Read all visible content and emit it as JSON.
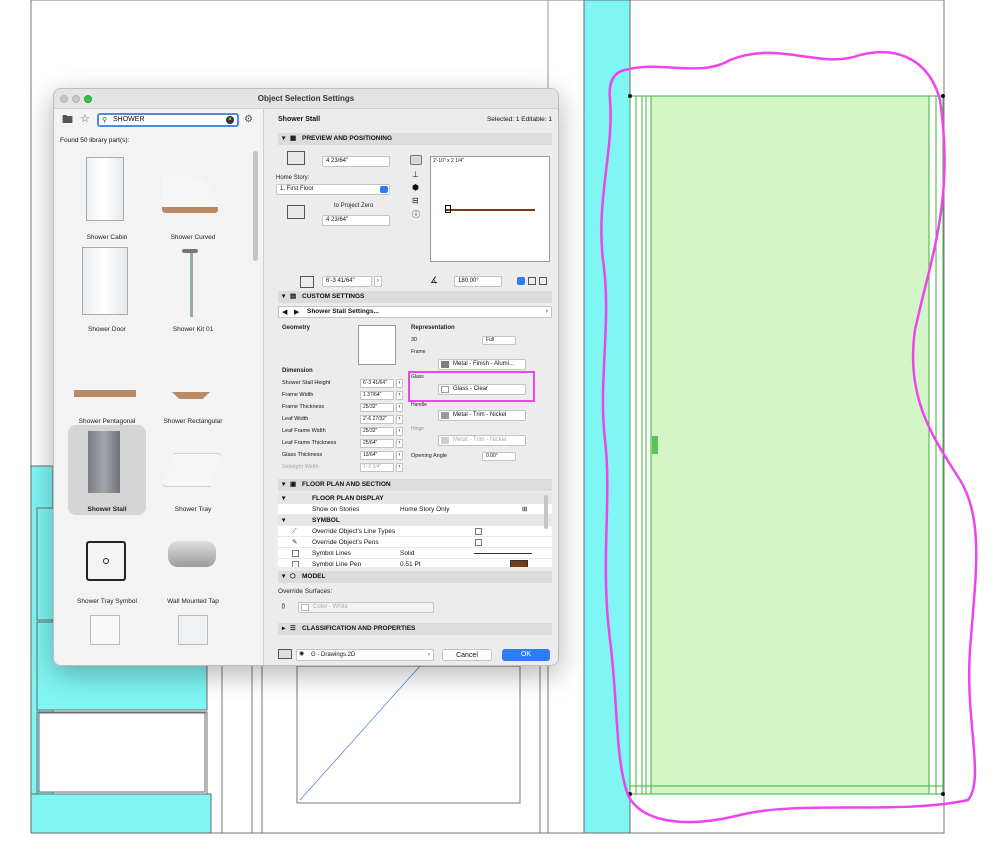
{
  "dialog": {
    "title": "Object Selection Settings",
    "search_value": "SHOWER",
    "found_text": "Found 50 library part(s):",
    "items": [
      {
        "label": "Shower Cabin"
      },
      {
        "label": "Shower Curved"
      },
      {
        "label": "Shower Door"
      },
      {
        "label": "Shower Kit 01"
      },
      {
        "label": "Shower Pentagonal"
      },
      {
        "label": "Shower Rectangular"
      },
      {
        "label": "Shower Stall"
      },
      {
        "label": "Shower Tray"
      },
      {
        "label": "Shower Tray Symbol"
      },
      {
        "label": "Wall Mounted Tap"
      }
    ],
    "selected_item": "Shower Stall",
    "header_name": "Shower Stall",
    "selected_info": "Selected: 1 Editable: 1",
    "preview": {
      "section_title": "PREVIEW AND POSITIONING",
      "top_value": "4 23/64\"",
      "home_story_label": "Home Story:",
      "home_story_value": "1. First Floor",
      "to_project_zero": "to Project Zero",
      "bottom_value": "4 23/64\"",
      "preview_caption": "2'-10\" x 2 1/4\"",
      "size_value": "6'-3 41/64\"",
      "angle_value": "180.00°"
    },
    "custom": {
      "section_title": "CUSTOM SETTINGS",
      "settings_name": "Shower Stall Settings...",
      "geometry_label": "Geometry",
      "dimension_label": "Dimension",
      "dims": [
        {
          "label": "Shower Stall Height",
          "value": "6'-3 41/64\""
        },
        {
          "label": "Frame Width",
          "value": "1 37/64\""
        },
        {
          "label": "Frame Thickness",
          "value": "25/32\""
        },
        {
          "label": "Leaf Width",
          "value": "2'-6 27/32\""
        },
        {
          "label": "Leaf Frame Width",
          "value": "25/32\""
        },
        {
          "label": "Leaf Frame Thickness",
          "value": "25/64\""
        },
        {
          "label": "Glass Thickness",
          "value": "13/64\""
        },
        {
          "label": "Sidelight Width",
          "value": "1'-0 3/4\""
        }
      ],
      "representation_label": "Representation",
      "rep_3d_label": "3D",
      "rep_3d_value": "Full",
      "frame_label": "Frame",
      "frame_value": "Metal - Finish - Alumi...",
      "glass_label": "Glass",
      "glass_value": "Glass - Clear",
      "handle_label": "Handle",
      "handle_value": "Metal - Trim - Nickel",
      "hinge_label": "Hinge",
      "hinge_value": "Metal - Trim - Nickel",
      "opening_angle_label": "Opening Angle",
      "opening_angle_value": "0.00°"
    },
    "floorplan": {
      "section_title": "FLOOR PLAN AND SECTION",
      "display_header": "FLOOR PLAN DISPLAY",
      "show_on_stories": "Show on Stories",
      "show_on_stories_value": "Home Story Only",
      "symbol_header": "SYMBOL",
      "override_line_types": "Override Object's Line Types",
      "override_pens": "Override Object's Pens",
      "symbol_lines": "Symbol Lines",
      "symbol_lines_value": "Solid",
      "symbol_line_pen": "Symbol Line Pen",
      "symbol_line_pen_value": "0.51 Pt"
    },
    "model": {
      "section_title": "MODEL",
      "override_surfaces": "Override Surfaces:",
      "surface_value": "Color - White"
    },
    "classification": {
      "section_title": "CLASSIFICATION AND PROPERTIES"
    },
    "footer": {
      "layer_value": "G - Drawings.2D",
      "cancel_label": "Cancel",
      "ok_label": "OK"
    }
  },
  "colors": {
    "cyan_fill": "#7ff6f4",
    "highlight_magenta": "#ee44ee",
    "green_fill": "#d4f6c6",
    "green_line": "#39b43a",
    "ok_blue": "#2f7bf5"
  }
}
